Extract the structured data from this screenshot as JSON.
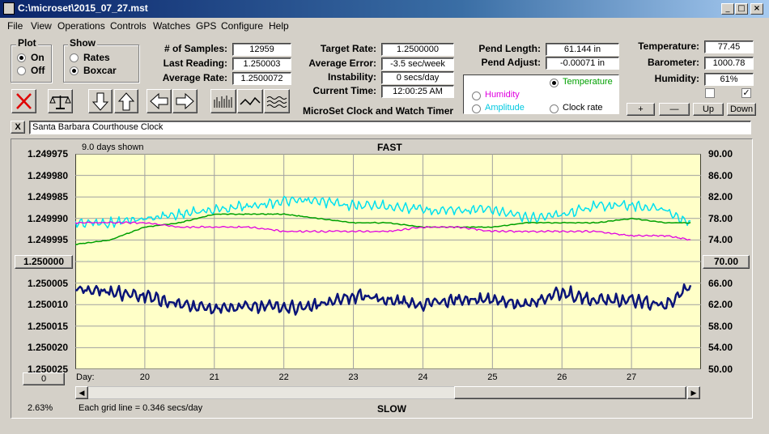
{
  "window": {
    "title": "C:\\microset\\2015_07_27.mst"
  },
  "menu": [
    "File",
    "View",
    "Operations",
    "Controls",
    "Watches",
    "GPS",
    "Configure",
    "Help"
  ],
  "plot_group": {
    "title": "Plot",
    "options": [
      "On",
      "Off"
    ],
    "selected": "On"
  },
  "show_group": {
    "title": "Show",
    "options": [
      "Rates",
      "Boxcar"
    ],
    "selected": "Boxcar"
  },
  "stats": {
    "samples_label": "# of Samples:",
    "samples": "12959",
    "last_reading_label": "Last Reading:",
    "last_reading": "1.250003",
    "average_rate_label": "Average Rate:",
    "average_rate": "1.2500072",
    "target_rate_label": "Target Rate:",
    "target_rate": "1.2500000",
    "average_error_label": "Average Error:",
    "average_error": "-3.5 sec/week",
    "instability_label": "Instability:",
    "instability": "0 secs/day",
    "current_time_label": "Current Time:",
    "current_time": "12:00:25 AM",
    "pend_length_label": "Pend Length:",
    "pend_length": "61.144 in",
    "pend_adjust_label": "Pend Adjust:",
    "pend_adjust": "-0.00071 in",
    "temperature_label": "Temperature:",
    "temperature": "77.45",
    "barometer_label": "Barometer:",
    "barometer": "1000.78",
    "humidity_label": "Humidity:",
    "humidity": "61%"
  },
  "app_label": "MicroSet Clock and Watch Timer",
  "sensor_select": {
    "options": [
      {
        "label": "Temperature",
        "color": "#00a000",
        "selected": true
      },
      {
        "label": "Humidity",
        "color": "#e000e0",
        "selected": false
      },
      {
        "label": "Amplitude",
        "color": "#00c8e0",
        "selected": false
      },
      {
        "label": "Clock rate",
        "color": "#000000",
        "selected": false
      }
    ]
  },
  "scale_buttons": {
    "plus": "+",
    "minus": "—",
    "up": "Up",
    "down": "Down"
  },
  "checkboxes": [
    {
      "checked": false
    },
    {
      "checked": true
    }
  ],
  "clock_name": "Santa Barbara Courthouse Clock",
  "close_x": "X",
  "chart": {
    "days_shown": "9.0 days shown",
    "top_label": "FAST",
    "bottom_label": "SLOW",
    "left_center_button": "1.250000",
    "right_center_button": "70.00",
    "left_bottom_button": "0",
    "day_prefix": "Day:",
    "percent": "2.63%",
    "grid_note": "Each grid line = 0.346 secs/day"
  },
  "chart_data": {
    "type": "line",
    "left_axis_ticks": [
      "1.249975",
      "1.249980",
      "1.249985",
      "1.249990",
      "1.249995",
      "1.250000",
      "1.250005",
      "1.250010",
      "1.250015",
      "1.250020",
      "1.250025"
    ],
    "right_axis_ticks": [
      "90.00",
      "86.00",
      "82.00",
      "78.00",
      "74.00",
      "70.00",
      "66.00",
      "62.00",
      "58.00",
      "54.00",
      "50.00"
    ],
    "x_days": [
      "20",
      "21",
      "22",
      "23",
      "24",
      "25",
      "26",
      "27"
    ],
    "ylim_left": [
      1.249975,
      1.250025
    ],
    "ylim_right": [
      50,
      90
    ],
    "series": [
      {
        "color": "#00e0f0",
        "axis": "left",
        "x": [
          19.0,
          19.5,
          20.0,
          20.5,
          21.0,
          21.5,
          22.0,
          22.5,
          23.0,
          23.5,
          24.0,
          24.5,
          25.0,
          25.5,
          26.0,
          26.5,
          27.0,
          27.5,
          27.85
        ],
        "y": [
          1.249991,
          1.249991,
          1.24999,
          1.249989,
          1.249988,
          1.249987,
          1.249986,
          1.249986,
          1.249987,
          1.249987,
          1.249988,
          1.249988,
          1.249988,
          1.24999,
          1.249989,
          1.249987,
          1.249987,
          1.249988,
          1.249991
        ]
      },
      {
        "color": "#00a000",
        "axis": "left",
        "x": [
          19.0,
          19.5,
          20.0,
          20.5,
          21.0,
          21.5,
          22.0,
          22.5,
          23.0,
          23.5,
          24.0,
          24.5,
          25.0,
          25.5,
          26.0,
          26.5,
          27.0,
          27.5,
          27.85
        ],
        "y": [
          1.249996,
          1.249995,
          1.249992,
          1.249991,
          1.249989,
          1.249989,
          1.249989,
          1.24999,
          1.249991,
          1.249991,
          1.249992,
          1.249992,
          1.249992,
          1.249991,
          1.249991,
          1.249991,
          1.24999,
          1.249991,
          1.249991
        ]
      },
      {
        "color": "#e000e0",
        "axis": "left",
        "x": [
          19.0,
          19.5,
          20.0,
          20.5,
          21.0,
          21.5,
          22.0,
          22.5,
          23.0,
          23.5,
          24.0,
          24.5,
          25.0,
          25.5,
          26.0,
          26.5,
          27.0,
          27.5,
          27.85
        ],
        "y": [
          1.249991,
          1.249991,
          1.249991,
          1.249992,
          1.249992,
          1.249992,
          1.249993,
          1.249993,
          1.249993,
          1.249993,
          1.249992,
          1.249992,
          1.249993,
          1.249993,
          1.249993,
          1.249993,
          1.249994,
          1.249994,
          1.249995
        ]
      },
      {
        "color": "#0a1478",
        "axis": "left",
        "x": [
          19.0,
          19.5,
          20.0,
          20.5,
          21.0,
          21.5,
          22.0,
          22.5,
          23.0,
          23.5,
          24.0,
          24.5,
          25.0,
          25.5,
          26.0,
          26.5,
          27.0,
          27.5,
          27.85
        ],
        "y": [
          1.250006,
          1.250007,
          1.250008,
          1.25001,
          1.250011,
          1.25001,
          1.250011,
          1.25001,
          1.250008,
          1.250009,
          1.25001,
          1.250009,
          1.250009,
          1.25001,
          1.250007,
          1.250009,
          1.250009,
          1.25001,
          1.250006
        ]
      }
    ]
  }
}
